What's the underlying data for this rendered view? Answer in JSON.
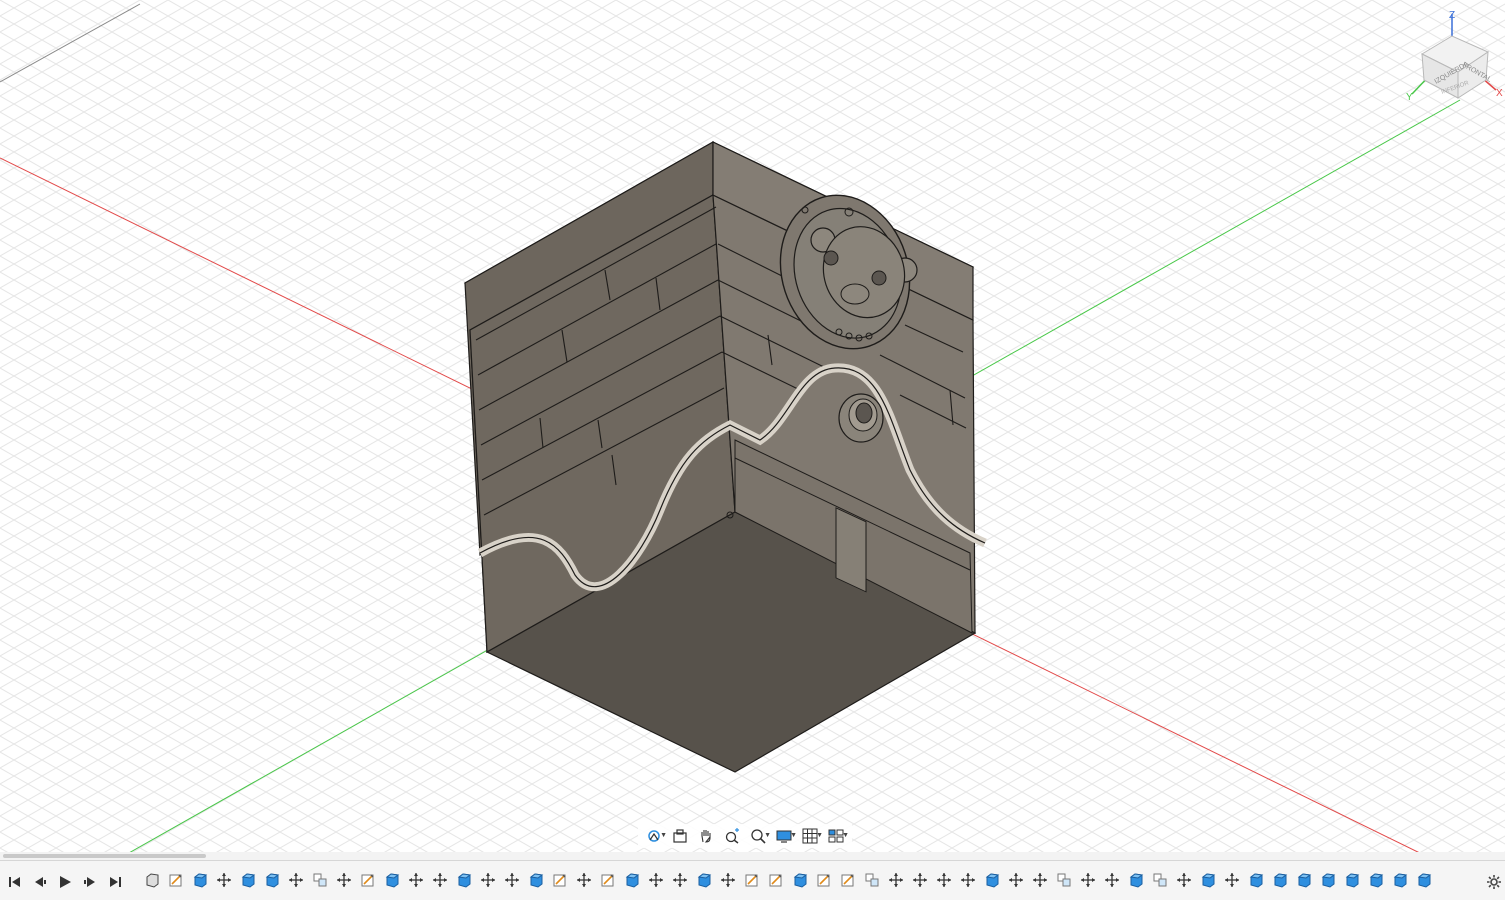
{
  "app": {
    "name": "3D CAD viewport"
  },
  "colors": {
    "grid": "#e4e4e4",
    "grid_major": "#d2d2d2",
    "axis_x": "#e24a4a",
    "axis_y": "#48c748",
    "model_top": "#7a736a",
    "model_left": "#6d665d",
    "model_right": "#807970",
    "model_bottom": "#57524b",
    "edge": "#1e1c1a",
    "accent_blue": "#2f8fdf",
    "timeline_bg": "#f5f5f5"
  },
  "viewcube": {
    "axis_z": "Z",
    "axis_x": "X",
    "axis_y": "Y",
    "face_left": "IZQUIERDA",
    "face_front": "FRONTAL",
    "face_bottom": "INFERIOR"
  },
  "nav_toolbar": [
    {
      "name": "orbit-icon",
      "dropdown": true
    },
    {
      "name": "look-at-icon",
      "dropdown": false
    },
    {
      "name": "pan-icon",
      "dropdown": false
    },
    {
      "name": "zoom-icon",
      "dropdown": false
    },
    {
      "name": "zoom-window-icon",
      "dropdown": true
    },
    {
      "name": "display-settings-icon",
      "dropdown": true
    },
    {
      "name": "grid-settings-icon",
      "dropdown": true
    },
    {
      "name": "viewports-icon",
      "dropdown": true
    }
  ],
  "timeline": {
    "playback": [
      "skip-to-start-icon",
      "step-back-icon",
      "play-icon",
      "step-forward-icon",
      "skip-to-end-icon"
    ],
    "features": [
      "sketch-icon",
      "extrude-icon",
      "move-icon",
      "extrude-icon",
      "extrude-icon",
      "move-icon",
      "copy-icon",
      "move-icon",
      "sketch-icon",
      "extrude-icon",
      "move-icon",
      "move-icon",
      "extrude-icon",
      "move-icon",
      "move-icon",
      "extrude-icon",
      "sketch-icon",
      "move-icon",
      "sketch-icon",
      "extrude-icon",
      "move-icon",
      "move-icon",
      "extrude-icon",
      "move-icon",
      "sketch-icon",
      "sketch-icon",
      "extrude-icon",
      "sketch-icon",
      "sketch-icon",
      "copy-icon",
      "move-icon",
      "move-icon",
      "move-icon",
      "move-icon",
      "extrude-icon",
      "move-icon",
      "move-icon",
      "copy-icon",
      "move-icon",
      "move-icon",
      "extrude-icon",
      "copy-icon",
      "move-icon",
      "extrude-icon",
      "move-icon",
      "extrude-icon",
      "extrude-icon",
      "extrude-icon",
      "extrude-icon",
      "extrude-icon",
      "extrude-icon",
      "extrude-icon",
      "extrude-icon"
    ]
  }
}
